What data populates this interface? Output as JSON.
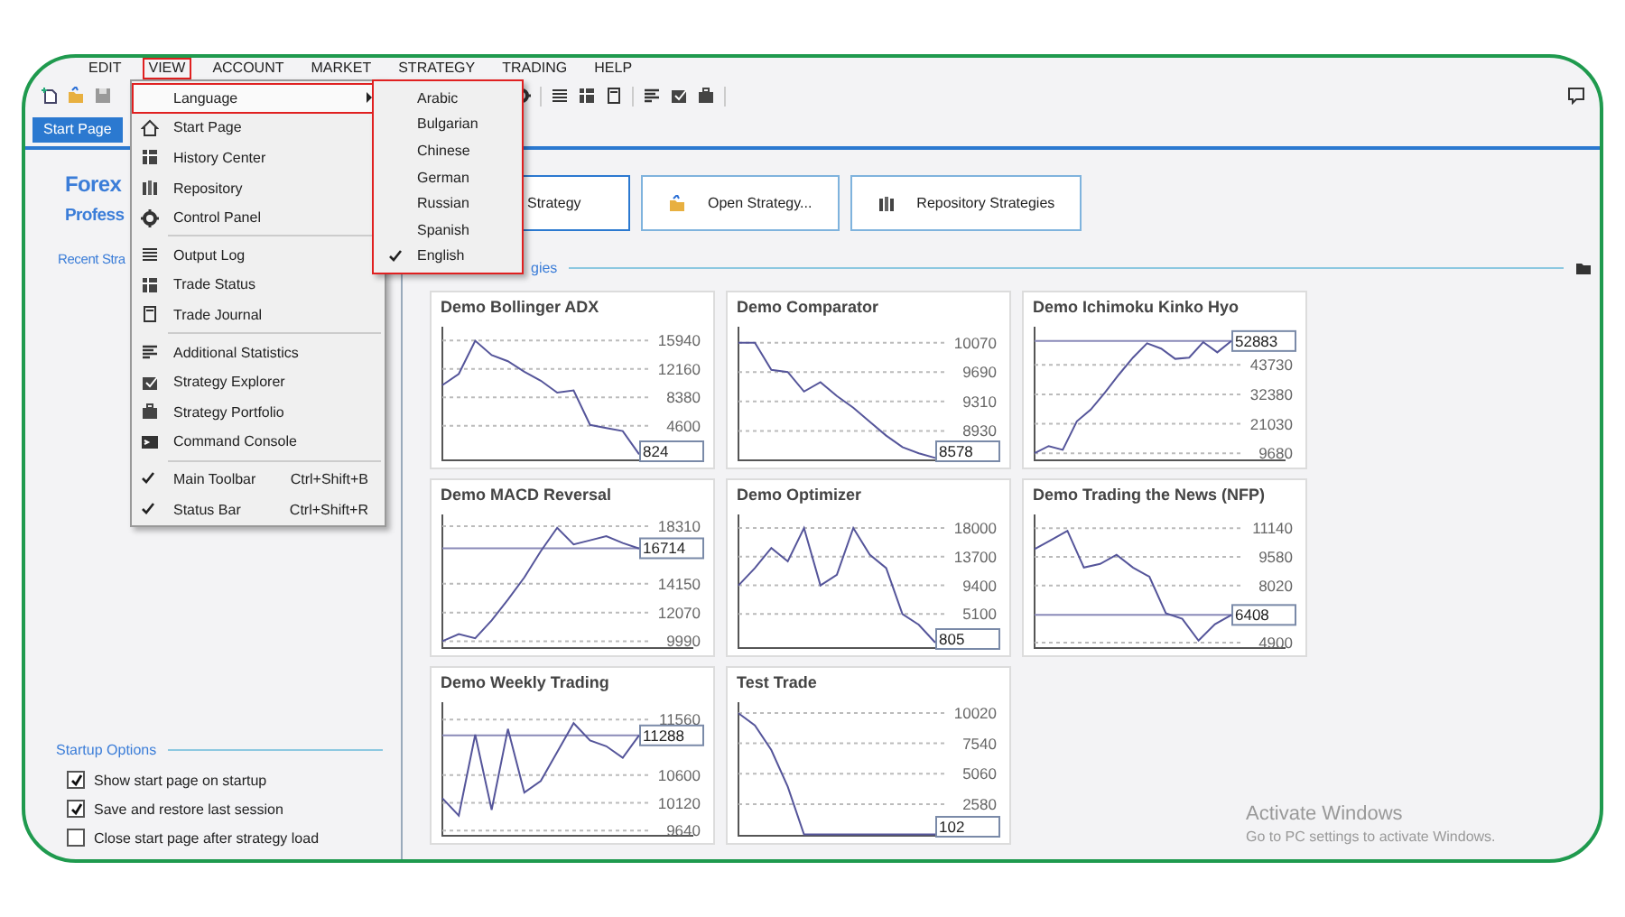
{
  "menubar": [
    {
      "label": "EDIT",
      "selected": false
    },
    {
      "label": "VIEW",
      "selected": true
    },
    {
      "label": "ACCOUNT",
      "selected": false
    },
    {
      "label": "MARKET",
      "selected": false
    },
    {
      "label": "STRATEGY",
      "selected": false
    },
    {
      "label": "TRADING",
      "selected": false
    },
    {
      "label": "HELP",
      "selected": false
    }
  ],
  "tab": {
    "label": "Start Page",
    "selected": true
  },
  "view_menu": {
    "items": [
      {
        "kind": "submenu",
        "label": "Language",
        "highlighted": true
      },
      {
        "kind": "item",
        "label": "Start Page"
      },
      {
        "kind": "item",
        "label": "History Center"
      },
      {
        "kind": "item",
        "label": "Repository"
      },
      {
        "kind": "item",
        "label": "Control Panel"
      },
      {
        "kind": "separator"
      },
      {
        "kind": "item",
        "label": "Output Log"
      },
      {
        "kind": "item",
        "label": "Trade Status"
      },
      {
        "kind": "item",
        "label": "Trade Journal"
      },
      {
        "kind": "separator"
      },
      {
        "kind": "item",
        "label": "Additional Statistics"
      },
      {
        "kind": "item",
        "label": "Strategy Explorer"
      },
      {
        "kind": "item",
        "label": "Strategy Portfolio"
      },
      {
        "kind": "item",
        "label": "Command Console"
      },
      {
        "kind": "separator"
      },
      {
        "kind": "check",
        "label": "Main Toolbar",
        "shortcut": "Ctrl+Shift+B",
        "checked": true
      },
      {
        "kind": "check",
        "label": "Status Bar",
        "shortcut": "Ctrl+Shift+R",
        "checked": true
      }
    ]
  },
  "language_menu": {
    "items": [
      {
        "label": "Arabic",
        "checked": false
      },
      {
        "label": "Bulgarian",
        "checked": false
      },
      {
        "label": "Chinese",
        "checked": false
      },
      {
        "label": "German",
        "checked": false
      },
      {
        "label": "Russian",
        "checked": false
      },
      {
        "label": "Spanish",
        "checked": false
      },
      {
        "label": "English",
        "checked": true
      }
    ]
  },
  "start_page": {
    "title": "Forex",
    "subtitle": "Profess",
    "recent_heading": "Recent Stra",
    "buttons": [
      "Strategy",
      "Open Strategy...",
      "Repository Strategies"
    ],
    "strategies_heading": "gies",
    "strategies": [
      {
        "title": "Demo Bollinger ADX",
        "current_value": "824",
        "chart_data": {
          "type": "line",
          "grid": true,
          "ylim": [
            0,
            17300
          ],
          "yticks": [
            15940,
            12160,
            8380,
            4600
          ],
          "series": [
            {
              "color": "#55559a",
              "values": [
                10000,
                11500,
                15900,
                14000,
                13200,
                11800,
                10600,
                9000,
                9300,
                4700,
                4300,
                3900,
                800
              ]
            }
          ]
        }
      },
      {
        "title": "Demo Comparator",
        "current_value": "8578",
        "chart_data": {
          "type": "line",
          "grid": true,
          "ylim": [
            8550,
            10230
          ],
          "yticks": [
            10070,
            9690,
            9310,
            8930
          ],
          "series": [
            {
              "color": "#55559a",
              "values": [
                10070,
                10070,
                9720,
                9690,
                9440,
                9560,
                9380,
                9230,
                9050,
                8870,
                8720,
                8640,
                8580
              ]
            }
          ]
        }
      },
      {
        "title": "Demo Ichimoku Kinko Hyo",
        "chart_data": {
          "type": "line",
          "grid": true,
          "ylim": [
            7000,
            57000
          ],
          "yticks": [
            43730,
            32380,
            21030,
            9680
          ],
          "ref_lines": [
            {
              "axis": "y",
              "value": 52883,
              "label": "52883"
            }
          ],
          "series": [
            {
              "color": "#55559a",
              "values": [
                9700,
                12500,
                11000,
                22000,
                26500,
                33000,
                40000,
                46500,
                52000,
                50000,
                46000,
                46500,
                52500,
                48500,
                52900
              ]
            }
          ]
        }
      },
      {
        "title": "Demo MACD Reversal",
        "chart_data": {
          "type": "line",
          "grid": true,
          "ylim": [
            9500,
            18900
          ],
          "yticks": [
            18310,
            14150,
            12070,
            9990
          ],
          "ref_lines": [
            {
              "axis": "y",
              "value": 16714,
              "label": "16714"
            }
          ],
          "series": [
            {
              "color": "#55559a",
              "values": [
                10000,
                10500,
                10200,
                11500,
                13000,
                14600,
                16500,
                18200,
                17000,
                17300,
                17600,
                17100,
                16700
              ]
            }
          ]
        }
      },
      {
        "title": "Demo Optimizer",
        "current_value": "805",
        "chart_data": {
          "type": "line",
          "grid": true,
          "ylim": [
            0,
            19500
          ],
          "yticks": [
            18000,
            13700,
            9400,
            5100
          ],
          "series": [
            {
              "color": "#55559a",
              "values": [
                9400,
                12000,
                15000,
                13000,
                18000,
                9400,
                11000,
                18000,
                14000,
                12000,
                5100,
                3500,
                800
              ]
            }
          ]
        }
      },
      {
        "title": "Demo Trading the News (NFP)",
        "chart_data": {
          "type": "line",
          "grid": true,
          "ylim": [
            4600,
            11700
          ],
          "yticks": [
            11140,
            9580,
            8020,
            4900
          ],
          "ref_lines": [
            {
              "axis": "y",
              "value": 6408,
              "label": "6408"
            }
          ],
          "series": [
            {
              "color": "#55559a",
              "values": [
                10000,
                10500,
                11000,
                9000,
                9200,
                9700,
                9000,
                8500,
                6500,
                6200,
                5000,
                5900,
                6400
              ]
            }
          ]
        }
      },
      {
        "title": "Demo Weekly Trading",
        "chart_data": {
          "type": "line",
          "grid": true,
          "ylim": [
            9550,
            11800
          ],
          "yticks": [
            11560,
            10600,
            10120,
            9640
          ],
          "ref_lines": [
            {
              "axis": "y",
              "value": 11288,
              "label": "11288"
            }
          ],
          "series": [
            {
              "color": "#55559a",
              "values": [
                10200,
                9900,
                11300,
                10000,
                11400,
                10300,
                10500,
                11000,
                11500,
                11200,
                11100,
                10900,
                11290
              ]
            }
          ]
        }
      },
      {
        "title": "Test Trade",
        "current_value": "102",
        "chart_data": {
          "type": "line",
          "grid": true,
          "ylim": [
            0,
            10600
          ],
          "yticks": [
            10020,
            7540,
            5060,
            2580
          ],
          "series": [
            {
              "color": "#55559a",
              "values": [
                10000,
                9000,
                7000,
                4000,
                100,
                100,
                100,
                100,
                100,
                100,
                100,
                100,
                100
              ]
            }
          ]
        }
      }
    ],
    "startup_options": {
      "heading": "Startup Options",
      "options": [
        {
          "label": "Show start page on startup",
          "checked": true
        },
        {
          "label": "Save and restore last session",
          "checked": true
        },
        {
          "label": "Close start page after strategy load",
          "checked": false
        }
      ]
    }
  },
  "os_notice": {
    "title": "Activate Windows",
    "text": "Go to PC settings to activate Windows."
  }
}
